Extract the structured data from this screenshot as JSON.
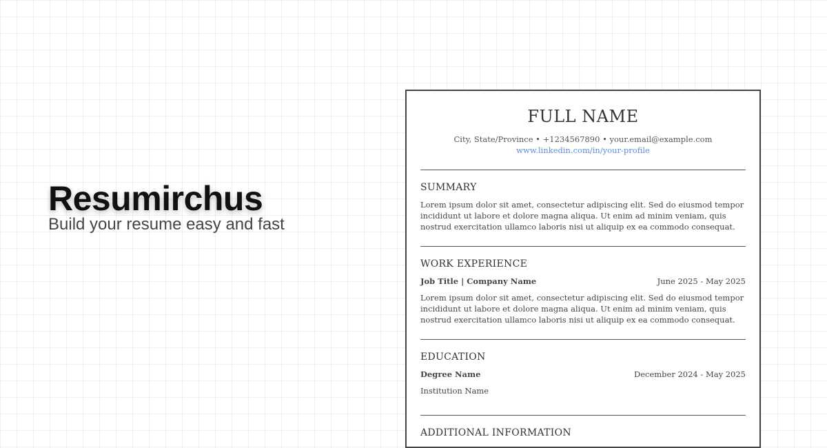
{
  "brand": {
    "title": "Resumirchus",
    "subtitle": "Build your resume easy and fast"
  },
  "resume": {
    "full_name": "FULL NAME",
    "contact": "City, State/Province • +1234567890 • your.email@example.com",
    "linkedin": "www.linkedin.com/in/your-profile",
    "summary": {
      "title": "SUMMARY",
      "text": "Lorem ipsum dolor sit amet, consectetur adipiscing elit. Sed do eiusmod tempor incididunt ut labore et dolore magna aliqua. Ut enim ad minim veniam, quis nostrud exercitation ullamco laboris nisi ut aliquip ex ea commodo consequat."
    },
    "work": {
      "title": "WORK EXPERIENCE",
      "job_title": "Job Title | Company Name",
      "dates": "June 2025 - May 2025",
      "text": "Lorem ipsum dolor sit amet, consectetur adipiscing elit. Sed do eiusmod tempor incididunt ut labore et dolore magna aliqua. Ut enim ad minim veniam, quis nostrud exercitation ullamco laboris nisi ut aliquip ex ea commodo consequat."
    },
    "education": {
      "title": "EDUCATION",
      "degree": "Degree Name",
      "dates": "December 2024 - May 2025",
      "institution": "Institution Name"
    },
    "additional": {
      "title": "ADDITIONAL INFORMATION"
    }
  },
  "colors": {
    "link": "#5b8ed8",
    "text": "#333333",
    "border": "#444444"
  }
}
